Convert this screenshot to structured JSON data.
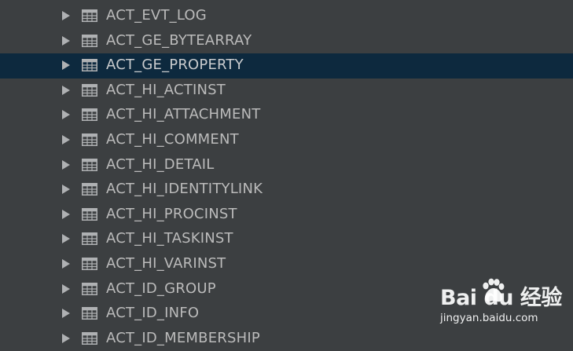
{
  "tree": {
    "items": [
      {
        "label": "ACT_EVT_LOG",
        "selected": false
      },
      {
        "label": "ACT_GE_BYTEARRAY",
        "selected": false
      },
      {
        "label": "ACT_GE_PROPERTY",
        "selected": true
      },
      {
        "label": "ACT_HI_ACTINST",
        "selected": false
      },
      {
        "label": "ACT_HI_ATTACHMENT",
        "selected": false
      },
      {
        "label": "ACT_HI_COMMENT",
        "selected": false
      },
      {
        "label": "ACT_HI_DETAIL",
        "selected": false
      },
      {
        "label": "ACT_HI_IDENTITYLINK",
        "selected": false
      },
      {
        "label": "ACT_HI_PROCINST",
        "selected": false
      },
      {
        "label": "ACT_HI_TASKINST",
        "selected": false
      },
      {
        "label": "ACT_HI_VARINST",
        "selected": false
      },
      {
        "label": "ACT_ID_GROUP",
        "selected": false
      },
      {
        "label": "ACT_ID_INFO",
        "selected": false
      },
      {
        "label": "ACT_ID_MEMBERSHIP",
        "selected": false
      }
    ]
  },
  "watermark": {
    "brand": "Bai du 经验",
    "url": "jingyan.baidu.com"
  },
  "colors": {
    "background": "#3c3f41",
    "selection": "#0d293e",
    "text": "#bbbbbb",
    "arrow": "#afb1b3",
    "icon": "#afb1b3"
  },
  "icons": {
    "expand": "triangle-right-icon",
    "table": "table-icon"
  }
}
